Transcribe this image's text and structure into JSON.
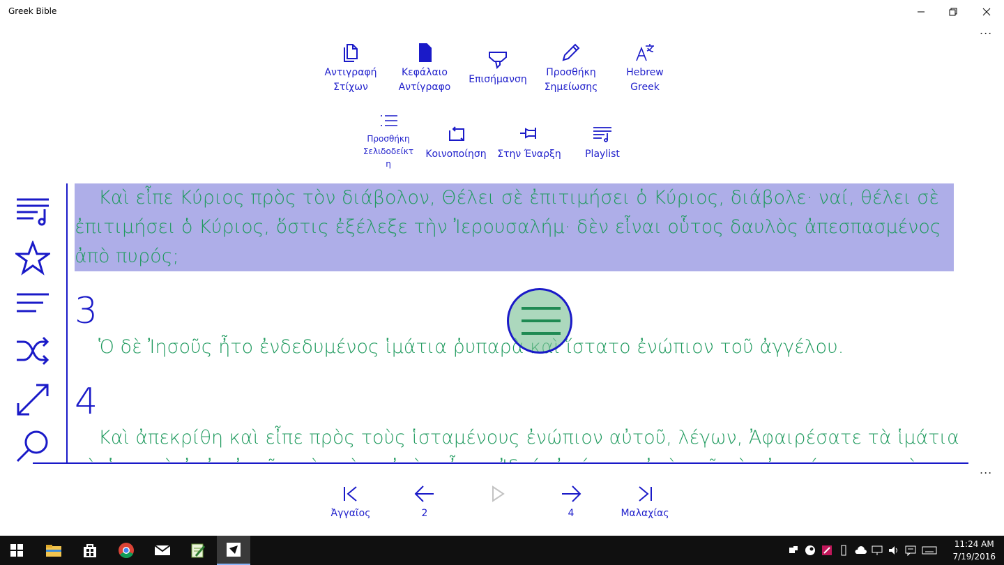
{
  "window": {
    "title": "Greek Bible",
    "controls": {
      "minimize_icon": "minimize-icon",
      "restore_icon": "restore-icon",
      "close_icon": "close-icon"
    },
    "more_label": "..."
  },
  "commands": [
    {
      "id": "copy-verses",
      "icon": "copy-icon",
      "label_lines": [
        "Αντιγραφή",
        "Στίχων"
      ]
    },
    {
      "id": "chapter-copy",
      "icon": "document-icon",
      "label_lines": [
        "Κεφάλαιο",
        "Αντίγραφο"
      ]
    },
    {
      "id": "highlight",
      "icon": "highlighter-icon",
      "label_lines": [
        "Επισήμανση"
      ]
    },
    {
      "id": "add-note",
      "icon": "pencil-icon",
      "label_lines": [
        "Προσθήκη",
        "Σημείωσης"
      ]
    },
    {
      "id": "hebrew-greek",
      "icon": "translate-icon",
      "label_lines": [
        "Hebrew",
        "Greek"
      ]
    },
    {
      "id": "add-bookmark",
      "icon": "bookmark-list-icon",
      "label_lines": [
        "Προσθήκη",
        "Σελιδοδείκτ",
        "η"
      ]
    },
    {
      "id": "share",
      "icon": "share-icon",
      "label_lines": [
        "Κοινοποίηση"
      ]
    },
    {
      "id": "pin-start",
      "icon": "pin-icon",
      "label_lines": [
        "Στην Έναρξη"
      ]
    },
    {
      "id": "playlist",
      "icon": "playlist-icon",
      "label_lines": [
        "Playlist"
      ]
    }
  ],
  "sidebar": [
    {
      "id": "playlist",
      "icon": "playlist-music-icon"
    },
    {
      "id": "favorites",
      "icon": "star-icon"
    },
    {
      "id": "contents",
      "icon": "list-icon"
    },
    {
      "id": "shuffle",
      "icon": "shuffle-icon"
    },
    {
      "id": "fullscreen",
      "icon": "expand-icon"
    },
    {
      "id": "search",
      "icon": "search-icon"
    }
  ],
  "reader": {
    "highlighted_verse": "Καὶ εἶπε Κύριος πρὸς τὸν διάβολον, Θέλει σὲ ἐπιτιμήσει ὁ Κύριος, διάβολε· ναί, θέλει σὲ ἐπιτιμήσει ὁ Κύριος, ὅστις ἐξέλεξε τὴν Ἰερουσαλήμ· δὲν εἶναι οὗτος δαυλὸς ἀπεσπασμένος ἀπὸ πυρός;",
    "verses": [
      {
        "number": "3",
        "text": "Ὁ δὲ Ἰησοῦς ἦτο ἐνδεδυμένος ἱμάτια ῥυπαρὰ καὶ ἵστατο ἐνώπιον τοῦ ἀγγέλου."
      },
      {
        "number": "4",
        "text": "Καὶ ἀπεκρίθη καὶ εἶπε πρὸς τοὺς ἱσταμένους ἐνώπιον αὐτοῦ, λέγων, Ἀφαιρέσατε τὰ ἱμάτια τὰ ῥυπαρὰ ἀπ᾿ αὐτοῦ· καὶ πρὸς αὐτὸν εἶπεν, Ἰδού, ἀφῄρεσα ἀπὸ σοῦ τὴν ἀνομίαν σου καὶ"
      }
    ],
    "fab_icon": "menu-icon"
  },
  "bottom_nav": [
    {
      "id": "first",
      "icon": "skip-back-icon",
      "label": "Ἀγγαῖος",
      "enabled": true
    },
    {
      "id": "prev",
      "icon": "arrow-left-icon",
      "label": "2",
      "enabled": true
    },
    {
      "id": "play",
      "icon": "play-icon",
      "label": "",
      "enabled": false
    },
    {
      "id": "next",
      "icon": "arrow-right-icon",
      "label": "4",
      "enabled": true
    },
    {
      "id": "last",
      "icon": "skip-forward-icon",
      "label": "Μαλαχίας",
      "enabled": true
    }
  ],
  "taskbar": {
    "apps": [
      "windows-start-icon",
      "file-explorer-icon",
      "store-icon",
      "chrome-icon",
      "mail-icon",
      "notepad-icon",
      "greek-bible-app-icon"
    ],
    "time": "11:24 AM",
    "date": "7/19/2016"
  },
  "colors": {
    "accent": "#1a1ac8",
    "verse_text": "#1f9a5e",
    "highlight": "#aeaee8",
    "taskbar": "#101010"
  }
}
